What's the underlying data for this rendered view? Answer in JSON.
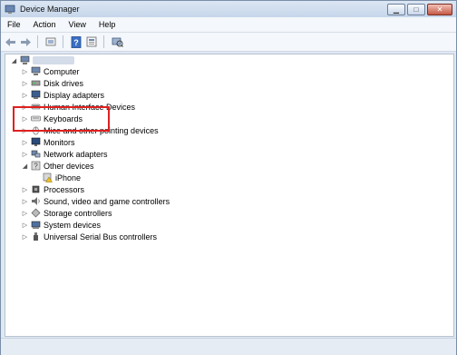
{
  "window": {
    "title": "Device Manager",
    "controls": {
      "minimize": "▁",
      "maximize": "□",
      "close": "✕"
    }
  },
  "menu": [
    "File",
    "Action",
    "View",
    "Help"
  ],
  "toolbar": [
    "back-icon",
    "forward-icon",
    "up-icon",
    "properties-icon",
    "help-icon",
    "view-icon",
    "scan-hardware-icon"
  ],
  "tree": {
    "categories": [
      {
        "label": "Computer",
        "icon": "computer-icon",
        "expanded": false
      },
      {
        "label": "Disk drives",
        "icon": "disk-drive-icon",
        "expanded": false
      },
      {
        "label": "Display adapters",
        "icon": "display-adapter-icon",
        "expanded": false
      },
      {
        "label": "Human Interface Devices",
        "icon": "hid-icon",
        "expanded": false
      },
      {
        "label": "Keyboards",
        "icon": "keyboard-icon",
        "expanded": false
      },
      {
        "label": "Mice and other pointing devices",
        "icon": "mouse-icon",
        "expanded": false
      },
      {
        "label": "Monitors",
        "icon": "monitor-icon",
        "expanded": false
      },
      {
        "label": "Network adapters",
        "icon": "network-adapter-icon",
        "expanded": false
      },
      {
        "label": "Other devices",
        "icon": "other-devices-icon",
        "expanded": true,
        "children": [
          {
            "label": "iPhone",
            "icon": "unknown-device-warning-icon"
          }
        ]
      },
      {
        "label": "Processors",
        "icon": "processor-icon",
        "expanded": false
      },
      {
        "label": "Sound, video and game controllers",
        "icon": "sound-icon",
        "expanded": false
      },
      {
        "label": "Storage controllers",
        "icon": "storage-controller-icon",
        "expanded": false
      },
      {
        "label": "System devices",
        "icon": "system-devices-icon",
        "expanded": false
      },
      {
        "label": "Universal Serial Bus controllers",
        "icon": "usb-icon",
        "expanded": false
      }
    ]
  },
  "colors": {
    "highlight": "#e02020",
    "selection_frame": "#7a8ea8"
  }
}
